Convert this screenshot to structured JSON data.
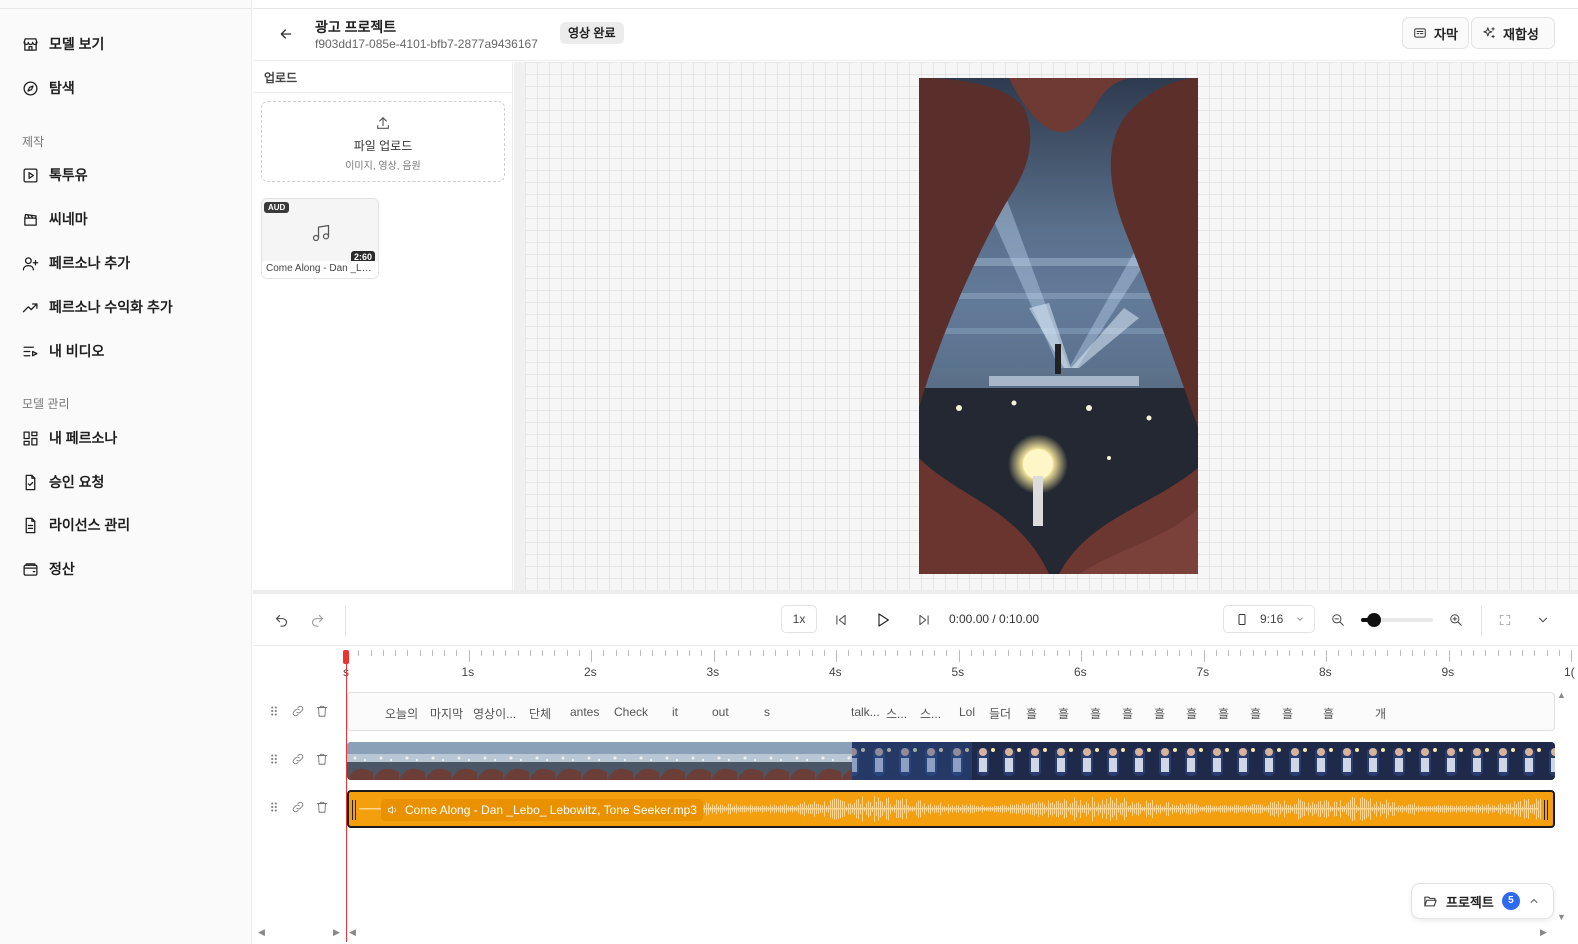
{
  "sidebar": {
    "items": [
      {
        "label": "모델 보기",
        "icon": "store-icon"
      },
      {
        "label": "탐색",
        "icon": "compass-icon"
      },
      {
        "label": "톡투유",
        "icon": "play-square-icon"
      },
      {
        "label": "씨네마",
        "icon": "clapperboard-icon"
      },
      {
        "label": "페르소나 추가",
        "icon": "user-plus-icon"
      },
      {
        "label": "페르소나 수익화 추가",
        "icon": "trending-up-icon"
      },
      {
        "label": "내 비디오",
        "icon": "list-video-icon"
      },
      {
        "label": "내 페르소나",
        "icon": "grid-icon"
      },
      {
        "label": "승인 요청",
        "icon": "file-check-icon"
      },
      {
        "label": "라이선스 관리",
        "icon": "file-text-icon"
      },
      {
        "label": "정산",
        "icon": "wallet-icon"
      }
    ],
    "sections": {
      "create": "제작",
      "model_manage": "모델 관리"
    }
  },
  "header": {
    "title": "광고 프로젝트",
    "project_id": "f903dd17-085e-4101-bfb7-2877a9436167",
    "status": "영상 완료",
    "subtitle_button": "자막",
    "recompose_button": "재합성"
  },
  "upload": {
    "label": "업로드",
    "dropzone_title": "파일 업로드",
    "dropzone_sub": "이미지, 영상, 음원",
    "media": {
      "type_badge": "AUD",
      "duration": "2:60",
      "name": "Come Along - Dan _Le..."
    }
  },
  "toolbar": {
    "speed": "1x",
    "time": "0:00.00 / 0:10.00",
    "ratio": "9:16",
    "zoom_level": 0.18
  },
  "ruler": {
    "labels": [
      "s",
      "1s",
      "2s",
      "3s",
      "4s",
      "5s",
      "6s",
      "7s",
      "8s",
      "9s",
      "1("
    ]
  },
  "subtitles": {
    "words": [
      "오늘의",
      "마지막",
      "영상이...",
      "단체",
      "antes",
      "Check",
      "it",
      "out",
      "s",
      "talk...",
      "스...",
      "스...",
      "Lol",
      "들더",
      "흘",
      "흘",
      "흘",
      "흘",
      "흘",
      "흘",
      "흘",
      "흘",
      "흘",
      "흘",
      "개"
    ]
  },
  "audio": {
    "name": "Come Along - Dan _Lebo_ Lebowitz, Tone Seeker.mp3"
  },
  "projects": {
    "label": "프로젝트",
    "count": "5"
  },
  "colors": {
    "audio_track": "#f4a00e",
    "playhead": "#e33333",
    "count_badge": "#2f6bf0"
  }
}
